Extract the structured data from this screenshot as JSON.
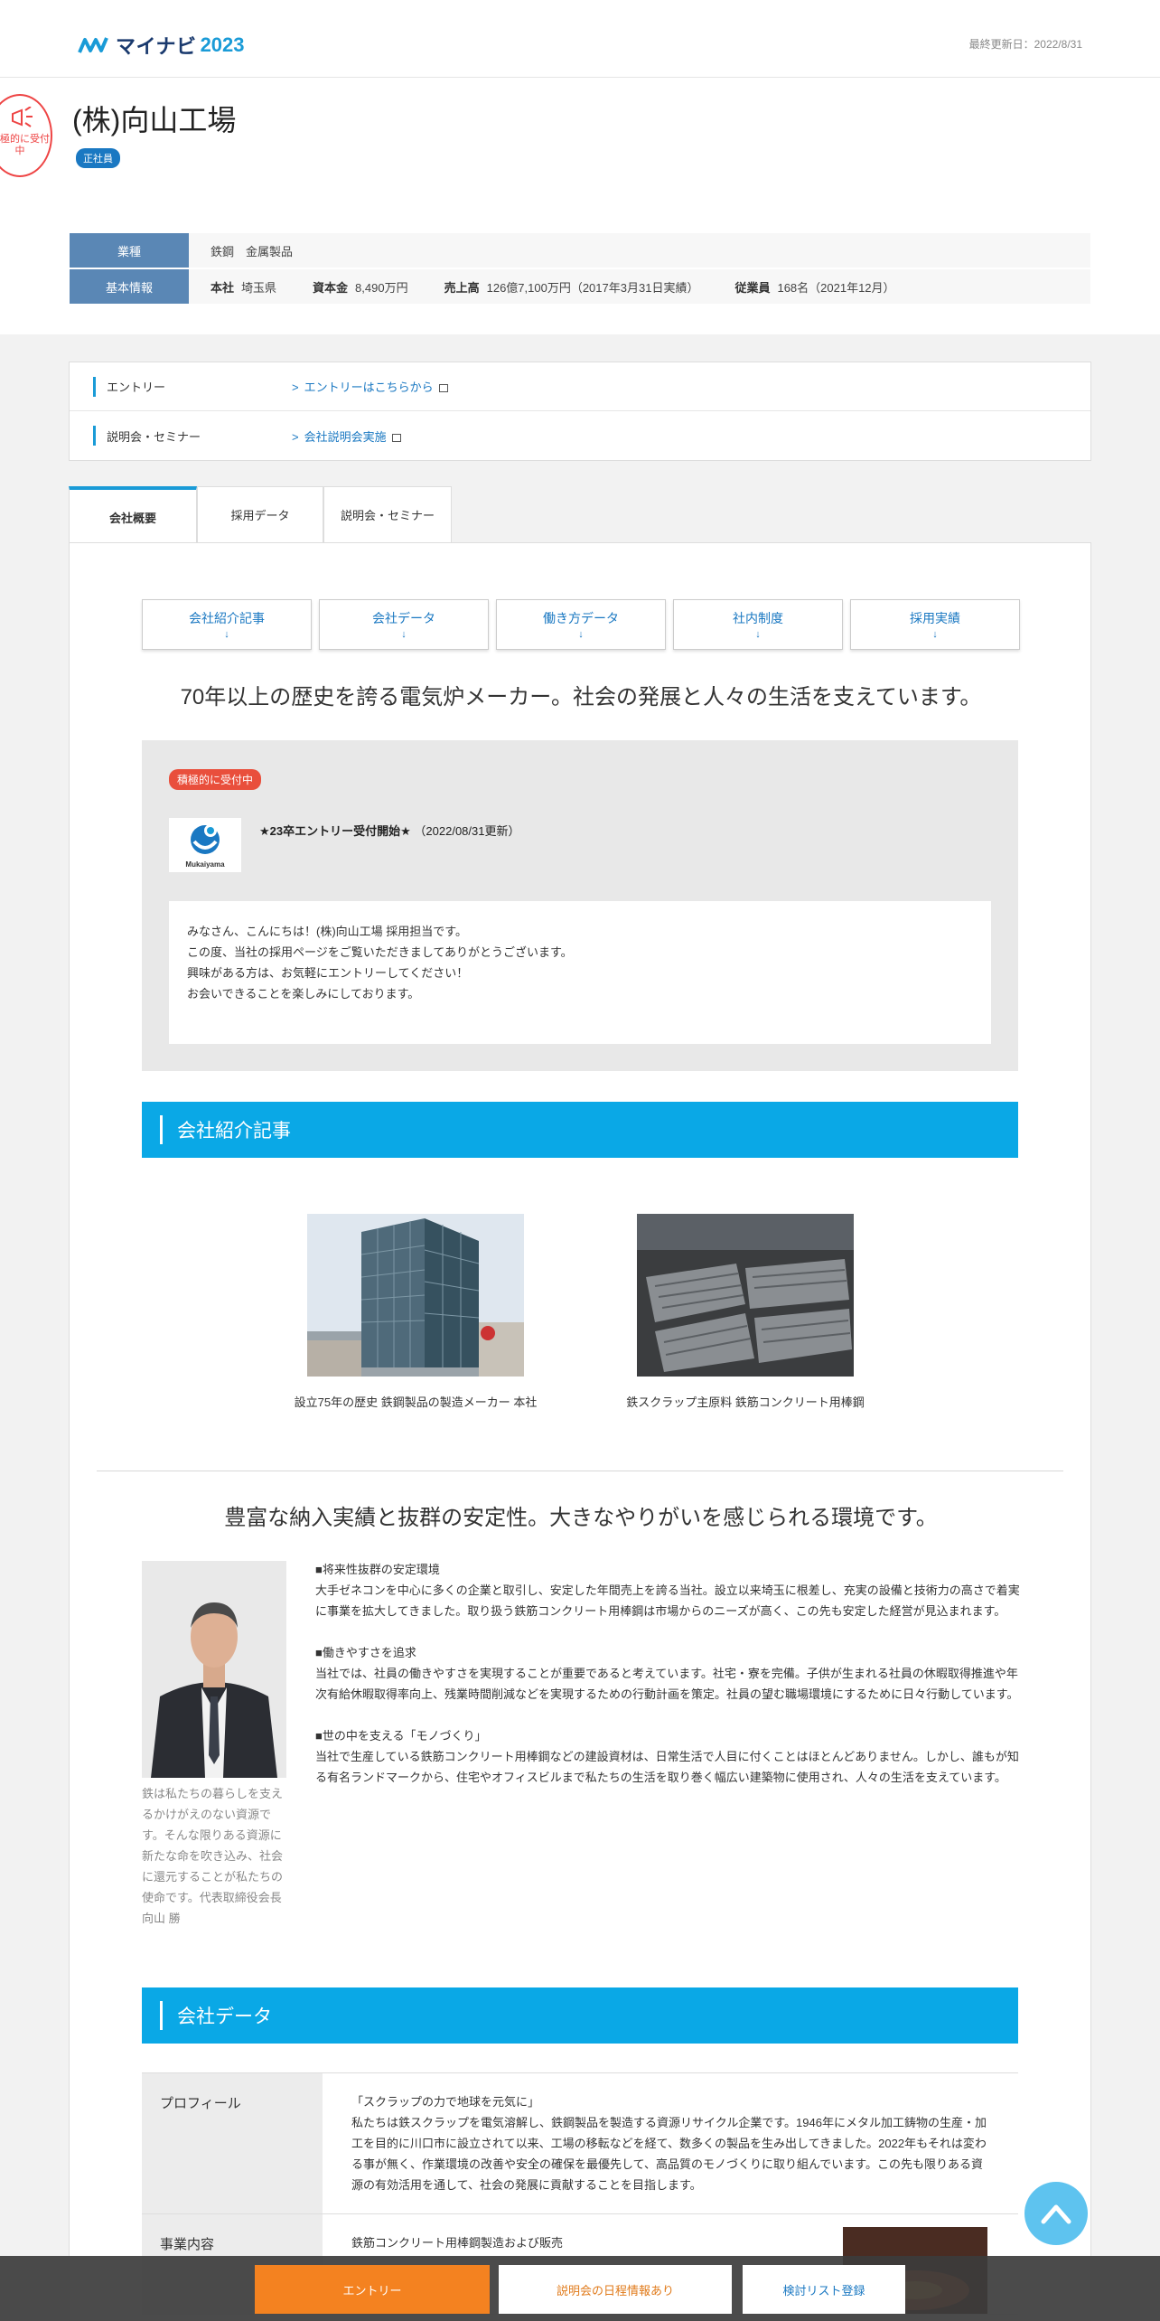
{
  "header": {
    "logo_text": "マイナビ",
    "logo_year": "2023",
    "updated": "最終更新日：2022/8/31"
  },
  "company": {
    "badge_text": "積極的に受付中",
    "name": "(株)向山工場",
    "employment_tag": "正社員"
  },
  "info": {
    "industry_label": "業種",
    "industry_value": "鉄鋼　金属製品",
    "basic_label": "基本情報",
    "hq_label": "本社",
    "hq_value": "埼玉県",
    "capital_label": "資本金",
    "capital_value": "8,490万円",
    "sales_label": "売上高",
    "sales_value": "126億7,100万円（2017年3月31日実績）",
    "staff_label": "従業員",
    "staff_value": "168名（2021年12月）"
  },
  "entry_box": {
    "entry_label": "エントリー",
    "entry_link": "エントリーはこちらから",
    "seminar_label": "説明会・セミナー",
    "seminar_link": "会社説明会実施"
  },
  "tabs": [
    "会社概要",
    "採用データ",
    "説明会・セミナー"
  ],
  "subnav": [
    "会社紹介記事",
    "会社データ",
    "働き方データ",
    "社内制度",
    "採用実績"
  ],
  "subnav_arrow": "↓",
  "catch1": "70年以上の歴史を誇る電気炉メーカー。社会の発展と人々の生活を支えています。",
  "message": {
    "tag": "積極的に受付中",
    "logo_caption": "Mukaiyama",
    "title": "★23卒エントリー受付開始★",
    "date": "（2022/08/31更新）",
    "lines": [
      "みなさん、こんにちは！(株)向山工場 採用担当です。",
      "この度、当社の採用ページをご覧いただきましてありがとうございます。",
      "興味がある方は、お気軽にエントリーしてください！",
      "お会いできることを楽しみにしております。"
    ]
  },
  "intro_section": {
    "title": "会社紹介記事",
    "caption1": "設立75年の歴史 鉄鋼製品の製造メーカー 本社",
    "caption2": "鉄スクラップ主原料 鉄筋コンクリート用棒鋼"
  },
  "catch2": "豊富な納入実績と抜群の安定性。大きなやりがいを感じられる環境です。",
  "president_caption": "鉄は私たちの暮らしを支えるかけがえのない資源です。そんな限りある資源に新たな命を吹き込み、社会に還元することが私たちの使命です。代表取締役会長　向山 勝",
  "feature_text": [
    {
      "heading": "■将来性抜群の安定環境",
      "body": "大手ゼネコンを中心に多くの企業と取引し、安定した年間売上を誇る当社。設立以来埼玉に根差し、充実の設備と技術力の高さで着実に事業を拡大してきました。取り扱う鉄筋コンクリート用棒鋼は市場からのニーズが高く、この先も安定した経営が見込まれます。"
    },
    {
      "heading": "■働きやすさを追求",
      "body": "当社では、社員の働きやすさを実現することが重要であると考えています。社宅・寮を完備。子供が生まれる社員の休暇取得推進や年次有給休暇取得率向上、残業時間削減などを実現するための行動計画を策定。社員の望む職場環境にするために日々行動しています。"
    },
    {
      "heading": "■世の中を支える「モノづくり」",
      "body": "当社で生産している鉄筋コンクリート用棒鋼などの建設資材は、日常生活で人目に付くことはほとんどありません。しかし、誰もが知る有名ランドマークから、住宅やオフィスビルまで私たちの生活を取り巻く幅広い建築物に使用され、人々の生活を支えています。"
    }
  ],
  "data_section": {
    "title": "会社データ",
    "profile_label": "プロフィール",
    "profile_lines": [
      "「スクラップの力で地球を元気に」",
      "私たちは鉄スクラップを電気溶解し、鉄鋼製品を製造する資源リサイクル企業です。1946年にメタル加工鋳物の生産・加工を目的に川口市に設立されて以来、工場の移転などを経て、数多くの製品を生み出してきました。2022年もそれは変わる事が無く、作業環境の改善や安全の確保を最優先して、高品質のモノづくりに取り組んでいます。この先も限りある資源の有効活用を通して、社会の発展に貢献することを目指します。"
    ],
    "business_label": "事業内容",
    "business_value": "鉄筋コンクリート用棒鋼製造および販売"
  },
  "bottom_bar": {
    "entry": "エントリー",
    "seminar": "説明会の日程情報あり",
    "list": "検討リスト登録"
  },
  "colors": {
    "accent_blue": "#0aa8e6",
    "link_blue": "#1a78c2",
    "entry_orange": "#f48220",
    "hot_red": "#e94f3c"
  }
}
